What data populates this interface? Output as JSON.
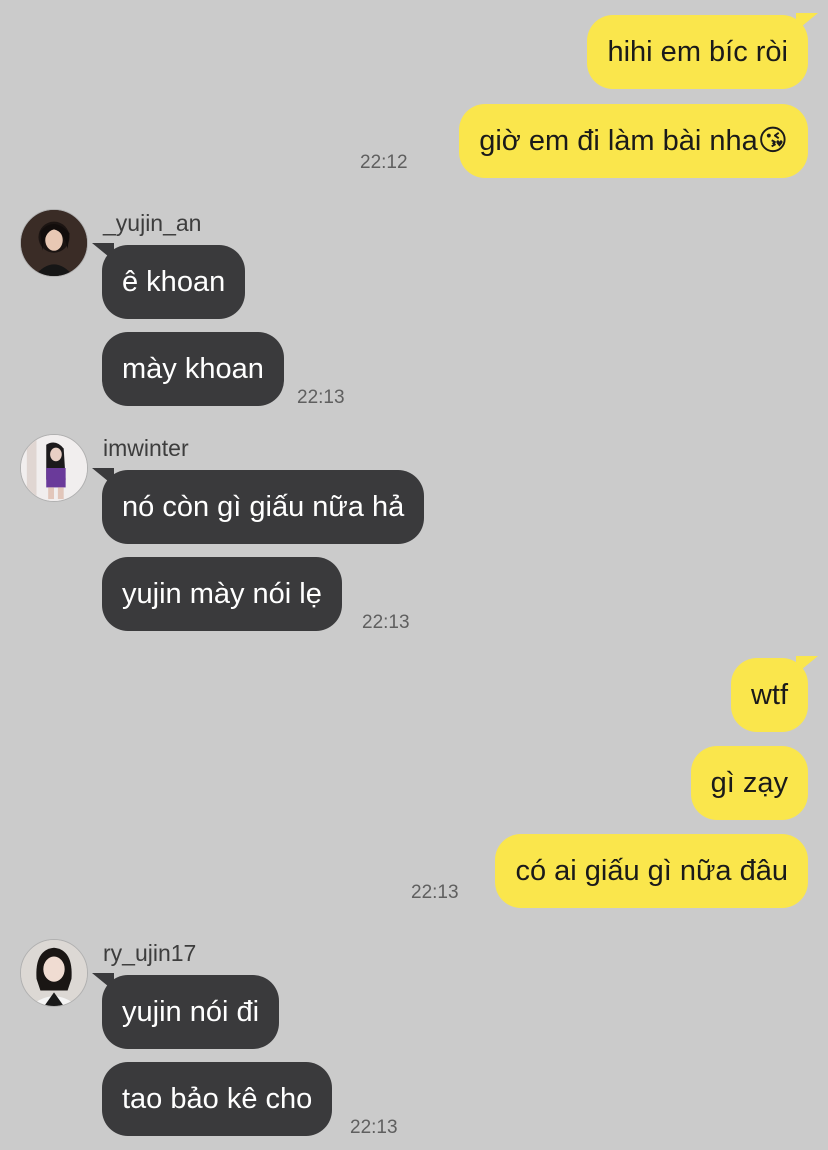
{
  "messages": {
    "m1": {
      "text": "hihi em bíc ròi"
    },
    "m2": {
      "text": "giờ em đi làm bài nha😘",
      "time": "22:12"
    },
    "m3": {
      "sender": "_yujin_an",
      "text": "ê khoan"
    },
    "m4": {
      "text": "mày khoan",
      "time": "22:13"
    },
    "m5": {
      "sender": "imwinter",
      "text": "nó còn gì giấu nữa hả"
    },
    "m6": {
      "text": "yujin mày nói lẹ",
      "time": "22:13"
    },
    "m7": {
      "text": "wtf"
    },
    "m8": {
      "text": "gì zạy"
    },
    "m9": {
      "text": "có ai giấu gì nữa đâu",
      "time": "22:13"
    },
    "m10": {
      "sender": "ry_ujin17",
      "text": "yujin nói đi"
    },
    "m11": {
      "text": "tao bảo kê cho",
      "time": "22:13"
    }
  },
  "colors": {
    "background": "#cbcbcb",
    "outgoing_bubble": "#fae64c",
    "incoming_bubble": "#3a3a3c"
  },
  "avatars": [
    "avatar-yujin-an",
    "avatar-imwinter",
    "avatar-ry-ujin17"
  ]
}
